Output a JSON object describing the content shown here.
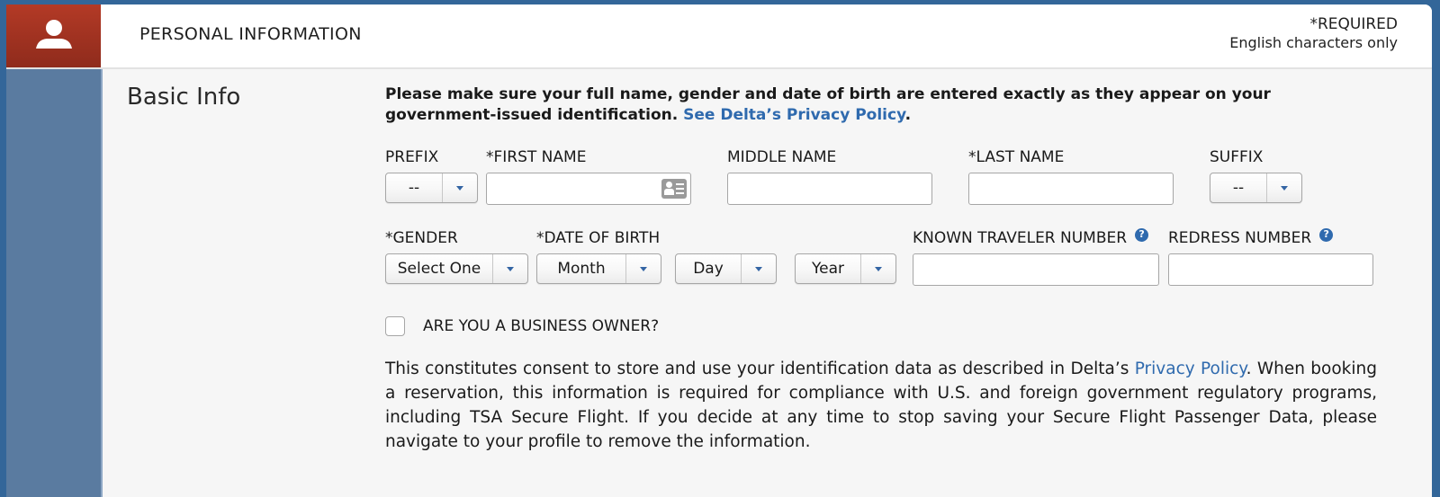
{
  "header": {
    "icon": "user-icon",
    "title": "PERSONAL INFORMATION",
    "required_note": "*REQUIRED",
    "charset_note": "English characters only"
  },
  "section": {
    "title": "Basic Info",
    "intro_text": "Please make sure your full name, gender and date of birth are entered exactly as they appear on your government-issued identification. ",
    "intro_link": "See Delta’s Privacy Policy",
    "intro_end": "."
  },
  "fields": {
    "prefix": {
      "label": "PREFIX",
      "value": "--"
    },
    "first_name": {
      "label": "*FIRST NAME",
      "value": "",
      "icon": "id-card-icon"
    },
    "middle_name": {
      "label": "MIDDLE NAME",
      "value": ""
    },
    "last_name": {
      "label": "*LAST NAME",
      "value": ""
    },
    "suffix": {
      "label": "SUFFIX",
      "value": "--"
    },
    "gender": {
      "label": "*GENDER",
      "value": "Select One"
    },
    "dob": {
      "label": "*DATE OF BIRTH",
      "month": "Month",
      "day": "Day",
      "year": "Year"
    },
    "known_traveler": {
      "label": "KNOWN TRAVELER NUMBER",
      "value": "",
      "help": "?"
    },
    "redress": {
      "label": "REDRESS NUMBER",
      "value": "",
      "help": "?"
    }
  },
  "business_owner": {
    "label": "ARE YOU A BUSINESS OWNER?",
    "checked": false
  },
  "consent": {
    "text_before": "This constitutes consent to store and use your identification data as described in Delta’s ",
    "link": "Privacy Policy",
    "text_after": ". When booking a reservation, this information is required for compliance with U.S. and foreign government regulatory programs, including TSA Secure Flight. If you decide at any time to stop saving your Secure Flight Passenger Data, please navigate to your profile to remove the information."
  },
  "colors": {
    "page_bg": "#336699",
    "icon_box": "#a53322",
    "side_rail": "#5a7ba0",
    "link": "#2f6aae"
  }
}
